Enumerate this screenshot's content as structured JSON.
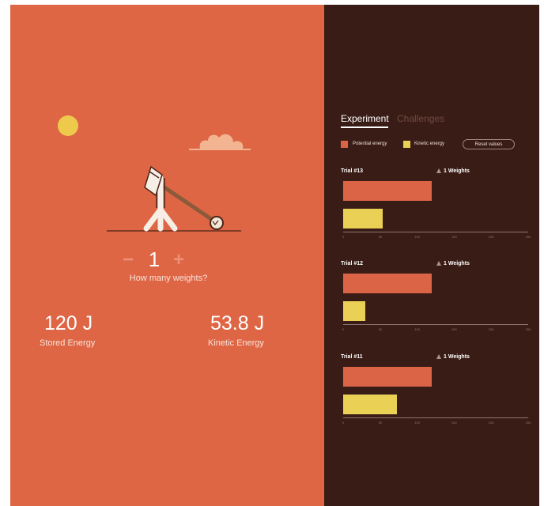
{
  "stepper": {
    "minus": "−",
    "count": "1",
    "plus": "+",
    "prompt": "How many weights?"
  },
  "energy": {
    "stored_value": "120 J",
    "stored_label": "Stored Energy",
    "kinetic_value": "53.8 J",
    "kinetic_label": "Kinetic Energy"
  },
  "tabs": [
    {
      "label": "Experiment"
    },
    {
      "label": "Challenges"
    }
  ],
  "legend": {
    "potential": {
      "label": "Potential energy",
      "color": "#dc6446"
    },
    "kinetic": {
      "label": "Kinetic energy",
      "color": "#ead055"
    }
  },
  "reset_label": "Reset values",
  "colors": {
    "left_bg": "#de6645",
    "right_bg": "#3a1c16",
    "sun": "#eeca4c",
    "cloud": "#f2b491"
  },
  "chart_data": [
    {
      "type": "bar",
      "title": "Trial #13",
      "weights": "1 Weights",
      "ticks": [
        0,
        50,
        100,
        150,
        200,
        250
      ],
      "xlim": [
        0,
        250
      ],
      "potential": 120,
      "kinetic": 53.8
    },
    {
      "type": "bar",
      "title": "Trial #12",
      "weights": "1 Weights",
      "ticks": [
        0,
        50,
        100,
        150,
        200,
        250
      ],
      "xlim": [
        0,
        250
      ],
      "potential": 120,
      "kinetic": 30
    },
    {
      "type": "bar",
      "title": "Trial #11",
      "weights": "1 Weights",
      "ticks": [
        0,
        50,
        100,
        150,
        200,
        250
      ],
      "xlim": [
        0,
        250
      ],
      "potential": 120,
      "kinetic": 73
    }
  ]
}
